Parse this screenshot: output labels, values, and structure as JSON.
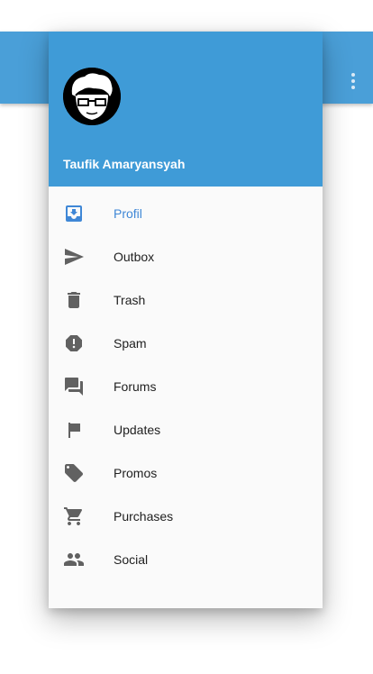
{
  "colors": {
    "header": "#3f9bd7",
    "appbar": "#4a9fd8",
    "accent": "#3f87d6",
    "icon": "#616161",
    "text": "#212121"
  },
  "appbar": {
    "overflow_icon": "more-vert-icon"
  },
  "drawer": {
    "user": {
      "name": "Taufik Amaryansyah",
      "avatar_icon": "avatar-glasses-icon"
    },
    "items": [
      {
        "label": "Profil",
        "icon": "inbox-icon",
        "active": true
      },
      {
        "label": "Outbox",
        "icon": "send-icon",
        "active": false
      },
      {
        "label": "Trash",
        "icon": "delete-icon",
        "active": false
      },
      {
        "label": "Spam",
        "icon": "report-icon",
        "active": false
      },
      {
        "label": "Forums",
        "icon": "forum-icon",
        "active": false
      },
      {
        "label": "Updates",
        "icon": "flag-icon",
        "active": false
      },
      {
        "label": "Promos",
        "icon": "tag-icon",
        "active": false
      },
      {
        "label": "Purchases",
        "icon": "cart-icon",
        "active": false
      },
      {
        "label": "Social",
        "icon": "people-icon",
        "active": false
      }
    ]
  }
}
